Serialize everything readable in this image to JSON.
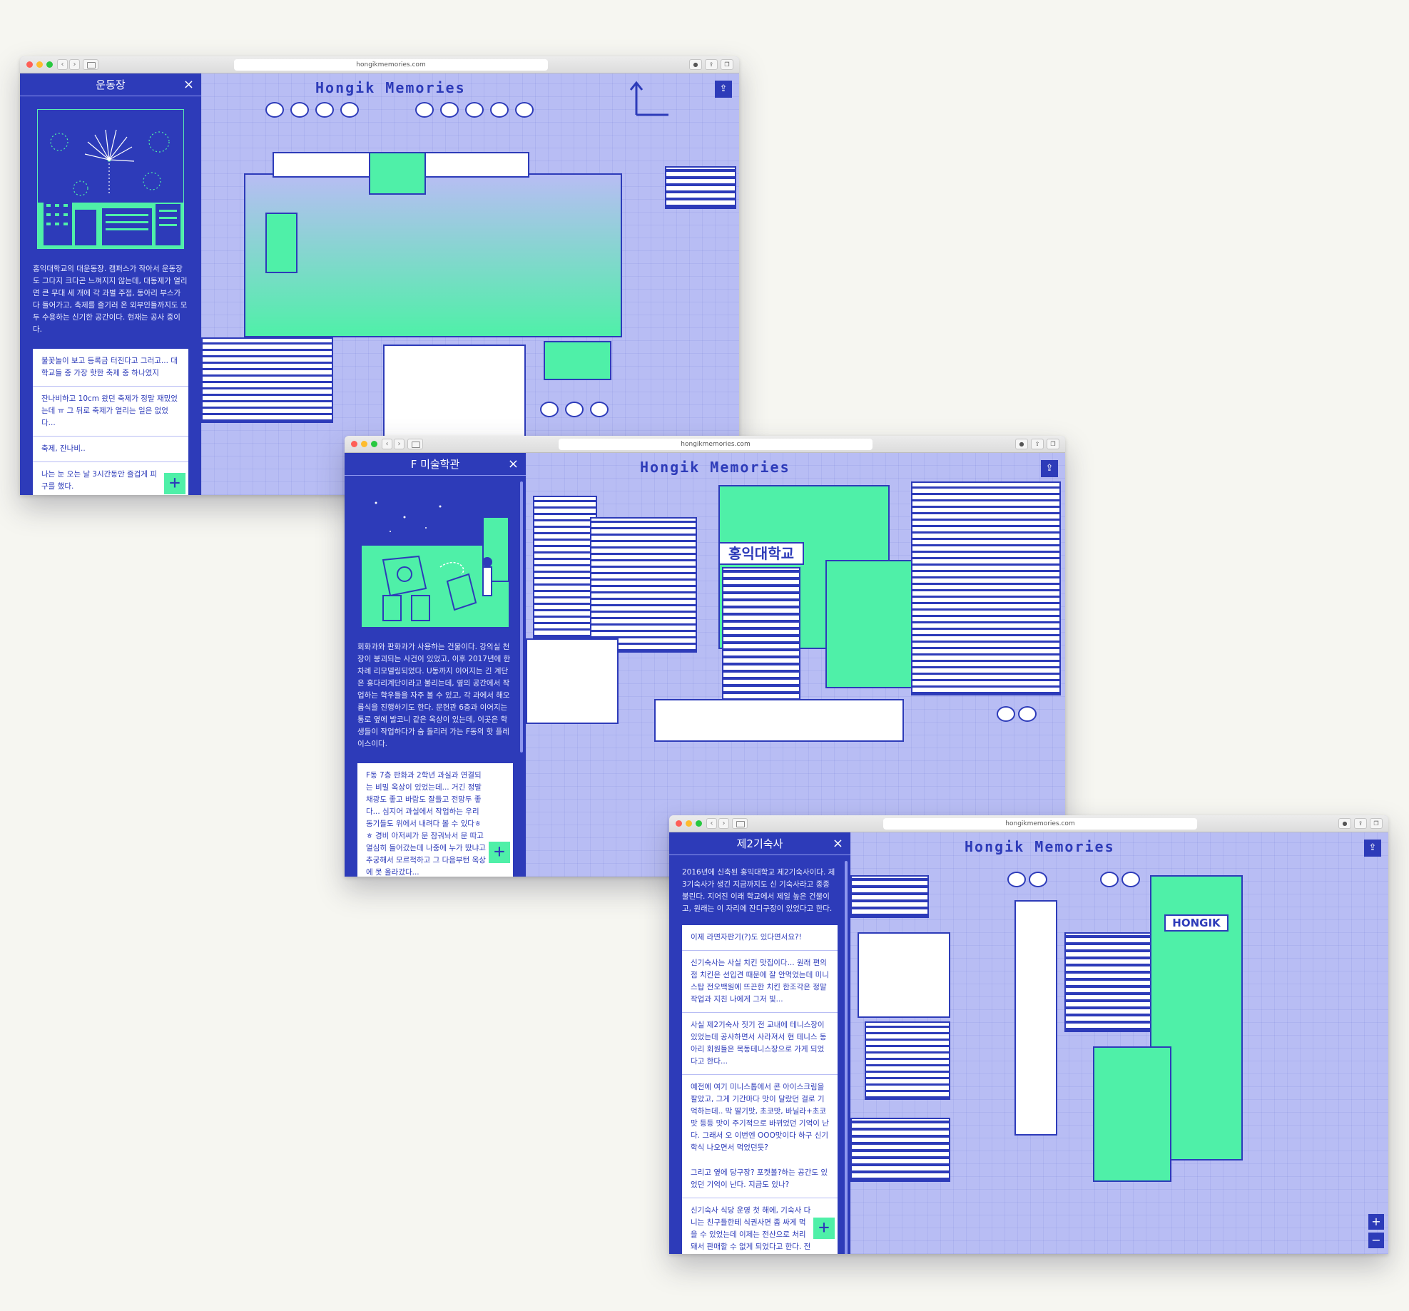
{
  "brand": {
    "logo": "Hongik Memories",
    "url": "hongikmemories.com",
    "accent": "#2d3bb9",
    "mint": "#4ff0a8",
    "map_bg": "#b8bdf4",
    "page_bg": "#f6f6f1"
  },
  "windows": [
    {
      "title": "운동장",
      "description": "홍익대학교의 대운동장. 캠퍼스가 작아서 운동장도 그다지 크다곤 느껴지지 않는데, 대동제가 열리면 큰 무대 세 개에 각 과별 주점, 동아리 부스가 다 들어가고, 축제를 즐기러 온 외부인들까지도 모두 수용하는 신기한 공간이다. 현재는 공사 중이다.",
      "comments": [
        "불꽃놀이 보고 등록금 터진다고 그러고... 대학교들 중 가장 핫한 축제 중 하나였지",
        "잔나비하고 10cm 왔던 축제가 정말 재밌었는데 ㅠ 그 뒤로 축제가 열리는 일은 없었다...",
        "축제, 잔나비..",
        "나는 눈 오는 날 3시간동안 즐겁게 피구를 했다."
      ]
    },
    {
      "title": "F 미술학관",
      "description": "회화과와 판화과가 사용하는 건물이다. 강의실 천장이 붕괴되는 사건이 있었고, 이후 2017년에 한차례 리모델링되었다. U동까지 이어지는 긴 계단은 홍다리계단이라고 불리는데, 옆의 공간에서 작업하는 학우들을 자주 볼 수 있고, 각 과에서 해오름식을 진행하기도 한다. 문헌관 6층과 이어지는 통로 옆에 발코니 같은 옥상이 있는데, 이곳은 학생들이 작업하다가 숨 돌리러 가는 F동의 핫 플레이스이다.",
      "comments": [
        "F동 7층 판화과 2학년 과실과 연결되는 비밀 옥상이 있었는데... 거긴 정말 채광도 좋고 바람도 잘들고 전망두 좋다... 심지어 과실에서 작업하는 우리 동기들도 위에서 내려다 볼 수 있다ㅎㅎ 경비 아저씨가 문 잠궈놔서 문 따고 열심히 들어갔는데 나중에 누가 땄냐고 추궁해서 모르척하고 그 다음부턴 옥상에 못 올라갔다..."
      ],
      "building_sign": "홍익대학교"
    },
    {
      "title": "제2기숙사",
      "description": "2016년에 신축된 홍익대학교 제2기숙사이다. 제3기숙사가 생긴 지금까지도 신 기숙사라고 종종 불린다. 지어진 이래 학교에서 제일 높은 건물이고, 원래는 이 자리에 잔디구장이 있었다고 한다.",
      "comments": [
        "이제 라면자판기(?)도 있다면서요?!",
        "신기숙사는 사실 치킨 맛집이다... 원래 편의점 치킨은 선입견 때문에 잘 안먹었는데 미니스탑 전오백원에 뜨끈한 치킨 한조각은 정말 작업과 지친 나에게 그저 빛...",
        "사실 제2기숙사 짓기 전 교내에 테니스장이 있었는데 공사하면서 사라져서 현 테니스 동아리 회원들은 목동테니스장으로 가게 되었다고 한다...",
        "예전에 여기 미니스톱에서 콘 아이스크림을 팔았고, 그게 기간마다 맛이 달랐던 걸로 기억하는데.. 막 딸기맛, 초코맛, 바닐라+초코맛 등등 맛이 주기적으로 바뀌었던 기억이 난다. 그래서 오 이번엔 OOO맛이다 하구 신기 학식 나오면서 먹었던듯?",
        "그리고 옆에 당구장? 포켓볼?하는 공간도 있었던 기억이 난다. 지금도 있나?",
        "신기숙사 식당 운영 첫 해에, 기숙사 다니는 친구들한테 식권사면 좀 싸게 먹을 수 있었는데 이제는 전산으로 처리돼서 판매할 수 없게 되었다고 한다. 전산으로 바뀌기 전 마"
      ],
      "building_sign": "HONGIK",
      "zoom_in": "+",
      "zoom_out": "−"
    }
  ],
  "icons": {
    "close": "×",
    "plus": "+",
    "share": "⇪",
    "back": "‹",
    "forward": "›"
  }
}
